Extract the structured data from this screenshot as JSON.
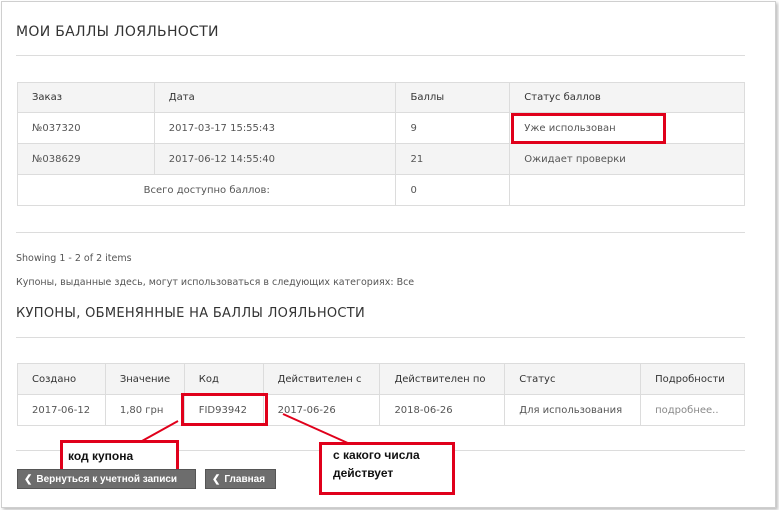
{
  "loyalty": {
    "title": "МОИ БАЛЛЫ ЛОЯЛЬНОСТИ",
    "headers": [
      "Заказ",
      "Дата",
      "Баллы",
      "Статус баллов"
    ],
    "rows": [
      {
        "order": "№037320",
        "date": "2017-03-17 15:55:43",
        "points": "9",
        "status": "Уже использован"
      },
      {
        "order": "№038629",
        "date": "2017-06-12 14:55:40",
        "points": "21",
        "status": "Ожидает проверки"
      }
    ],
    "total_label": "Всего доступно баллов:",
    "total_value": "0"
  },
  "pager": {
    "summary": "Showing 1 - 2 of 2 items"
  },
  "coupons_note": "Купоны, выданные здесь, могут использоваться в следующих категориях: Все",
  "coupons": {
    "title": "КУПОНЫ, ОБМЕНЯННЫЕ НА БАЛЛЫ ЛОЯЛЬНОСТИ",
    "headers": [
      "Создано",
      "Значение",
      "Код",
      "Действителен с",
      "Действителен по",
      "Статус",
      "Подробности"
    ],
    "rows": [
      {
        "created": "2017-06-12",
        "value": "1,80 грн",
        "code": "FID93942",
        "valid_from": "2017-06-26",
        "valid_to": "2018-06-26",
        "status": "Для использования",
        "details": "подробнее.."
      }
    ]
  },
  "annotations": {
    "coupon_code": "код купона",
    "valid_from_line1": "с какого числа",
    "valid_from_line2": "действует",
    "accent_color": "#e0001b"
  },
  "buttons": {
    "back": "Вернуться к учетной записи",
    "home": "Главная"
  }
}
